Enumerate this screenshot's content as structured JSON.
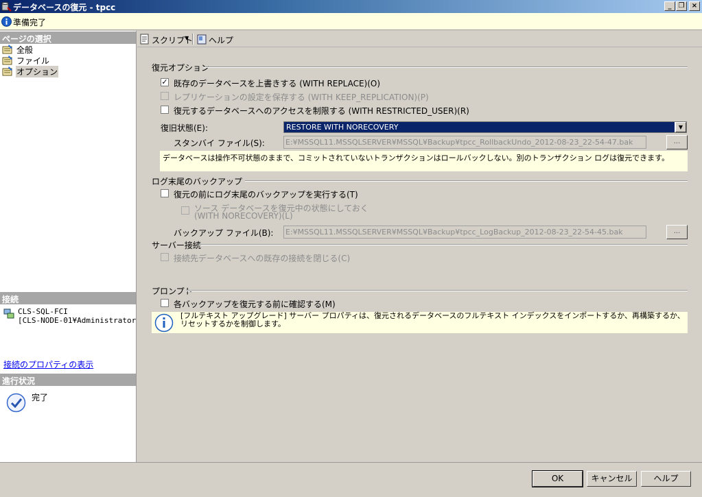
{
  "window": {
    "title": "データベースの復元 - tpcc",
    "icons": {
      "app": "database-restore-icon",
      "minimize": "minimize-icon",
      "restore": "restore-icon",
      "close": "close-icon"
    }
  },
  "status": {
    "text": "準備完了",
    "icon": "info-icon"
  },
  "left_panel": {
    "select_page_header": "ページの選択",
    "pages": [
      {
        "label": "全般",
        "selected": false
      },
      {
        "label": "ファイル",
        "selected": false
      },
      {
        "label": "オプション",
        "selected": true
      }
    ],
    "connection_header": "接続",
    "connection": {
      "server": "CLS-SQL-FCI",
      "user": "[CLS-NODE-01¥Administrator]"
    },
    "connection_link": "接続のプロパティの表示",
    "progress_header": "進行状況",
    "progress_status": "完了"
  },
  "toolbar": {
    "script_label": "スクリプト",
    "help_label": "ヘルプ"
  },
  "restore_options": {
    "title": "復元オプション",
    "overwrite": {
      "label": "既存のデータベースを上書きする (WITH REPLACE)(O)",
      "checked": true,
      "enabled": true
    },
    "keep_replication": {
      "label": "レプリケーションの設定を保存する (WITH KEEP_REPLICATION)(P)",
      "checked": false,
      "enabled": false
    },
    "restricted_user": {
      "label": "復元するデータベースへのアクセスを制限する (WITH RESTRICTED_USER)(R)",
      "checked": false,
      "enabled": true
    },
    "recovery_state_label": "復旧状態(E):",
    "recovery_state_value": "RESTORE WITH NORECOVERY",
    "standby_label": "スタンバイ ファイル(S):",
    "standby_value": "E:¥MSSQL11.MSSQLSERVER¥MSSQL¥Backup¥tpcc_RollbackUndo_2012-08-23_22-54-47.bak",
    "browse_label": "...",
    "state_note": "データベースは操作不可状態のままで、コミットされていないトランザクションはロールバックしない。別のトランザクション ログは復元できます。"
  },
  "tail_log": {
    "title": "ログ末尾のバックアップ",
    "take_tail": {
      "label": "復元の前にログ末尾のバックアップを実行する(T)",
      "checked": false,
      "enabled": true
    },
    "leave_source_line1": "ソース データベースを復元中の状態にしておく",
    "leave_source_line2": "(WITH NORECOVERY)(L)",
    "backup_file_label": "バックアップ ファイル(B):",
    "backup_file_value": "E:¥MSSQL11.MSSQLSERVER¥MSSQL¥Backup¥tpcc_LogBackup_2012-08-23_22-54-45.bak",
    "browse_label": "..."
  },
  "server_connections": {
    "title": "サーバー接続",
    "close_existing": {
      "label": "接続先データベースへの既存の接続を閉じる(C)",
      "checked": false,
      "enabled": false
    }
  },
  "prompt": {
    "title": "プロンプト",
    "confirm": {
      "label": "各バックアップを復元する前に確認する(M)",
      "checked": false,
      "enabled": true
    }
  },
  "info_message": "[フルテキスト アップグレード] サーバー プロパティは、復元されるデータベースのフルテキスト インデックスをインポートするか、再構築するか、リセットするかを制御します。",
  "buttons": {
    "ok": "OK",
    "cancel": "キャンセル",
    "help": "ヘルプ"
  },
  "colors": {
    "title_gradient_start": "#0a246a",
    "selection": "#0a246a",
    "info_background": "#ffffe1",
    "section_header": "#a6a6a6"
  }
}
